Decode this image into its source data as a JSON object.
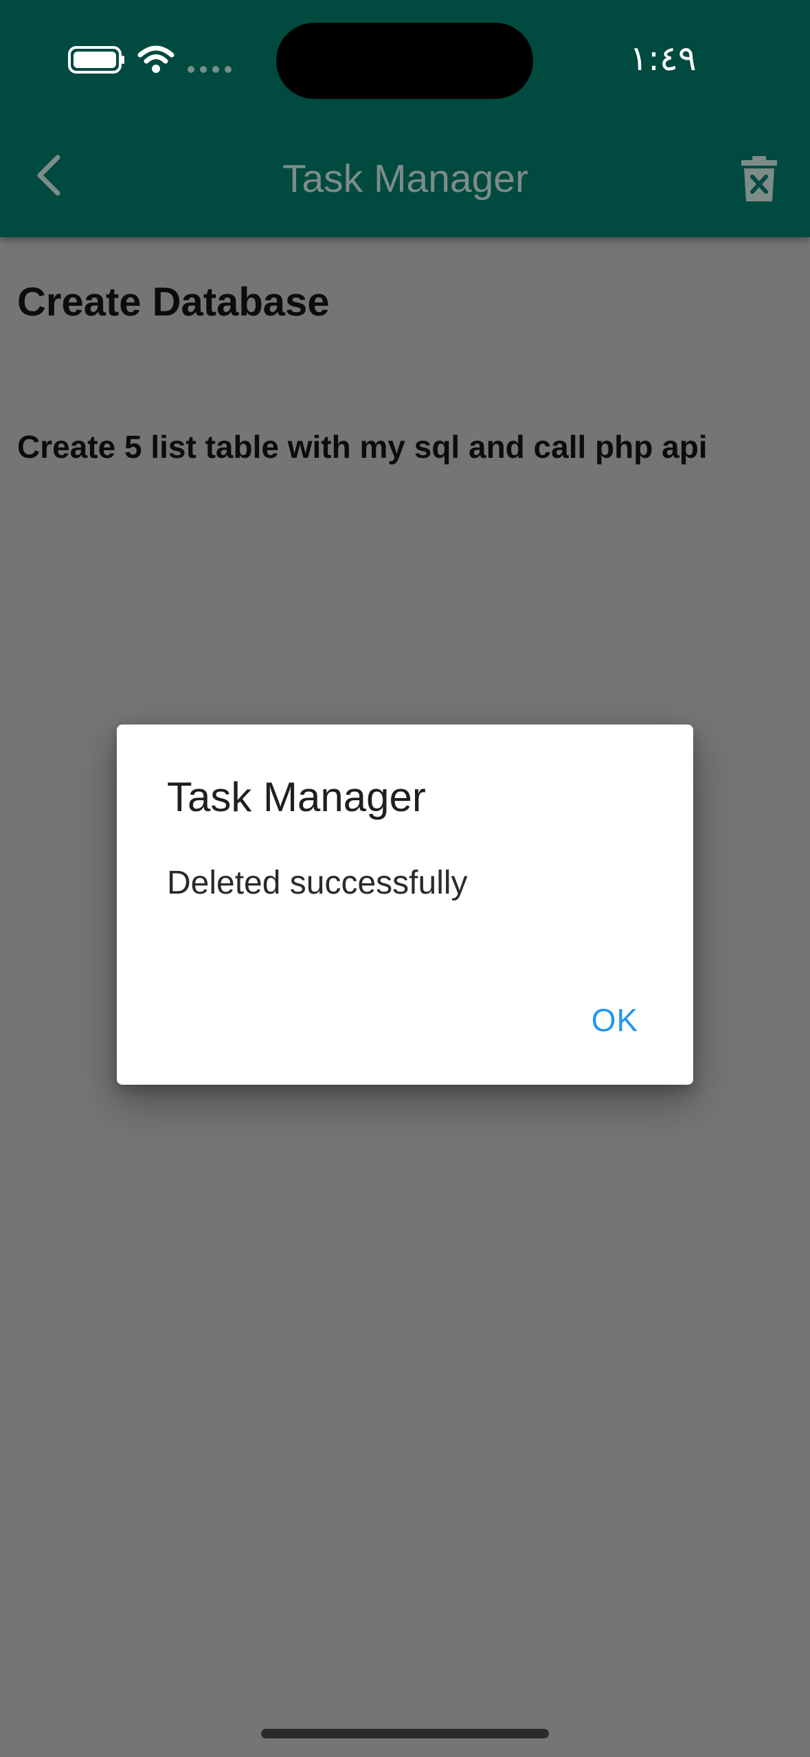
{
  "status_bar": {
    "time": "١:٤٩",
    "icons": [
      "battery-icon",
      "wifi-icon",
      "cellular-signal-icon"
    ]
  },
  "app_bar": {
    "title": "Task Manager",
    "back_icon": "chevron-left-icon",
    "delete_icon": "trash-x-icon",
    "background_color": "#004d40"
  },
  "task": {
    "title": "Create Database",
    "description": "Create 5 list table with my sql and call php api"
  },
  "dialog": {
    "title": "Task Manager",
    "message": "Deleted successfully",
    "ok_label": "OK",
    "ok_color": "#2196f3"
  }
}
